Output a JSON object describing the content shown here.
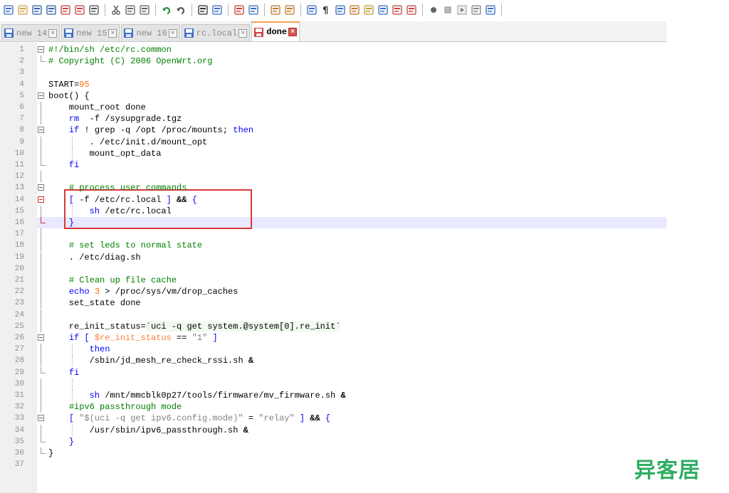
{
  "toolbar": {
    "icons": [
      "new-file-icon",
      "open-file-icon",
      "save-icon",
      "save-all-icon",
      "close-icon",
      "close-all-icon",
      "print-icon",
      "cut-icon",
      "copy-icon",
      "paste-icon",
      "undo-icon",
      "redo-icon",
      "find-icon",
      "replace-icon",
      "zoom-in-icon",
      "zoom-out-icon",
      "sync-vertical-icon",
      "sync-horizontal-icon",
      "word-wrap-icon",
      "show-all-chars-icon",
      "indent-guide-icon",
      "user-language-icon",
      "doc-map-icon",
      "function-list-icon",
      "folder-workspace-icon",
      "monitor-icon",
      "record-macro-icon",
      "stop-macro-icon",
      "play-macro-icon",
      "run-macro-multiple-icon",
      "save-macro-icon"
    ]
  },
  "tabs": [
    {
      "label": "new 14",
      "icon": "document-blue",
      "active": false
    },
    {
      "label": "new 15",
      "icon": "document-blue",
      "active": false
    },
    {
      "label": "new 16",
      "icon": "document-blue",
      "active": false
    },
    {
      "label": "rc.local",
      "icon": "document-blue",
      "active": false
    },
    {
      "label": "done",
      "icon": "document-red",
      "active": true
    }
  ],
  "tab_close_glyph": "×",
  "editor": {
    "current_line": 16,
    "lines": [
      {
        "n": "1",
        "tokens": [
          [
            "cm",
            "#!/bin/sh /etc/rc.common"
          ]
        ]
      },
      {
        "n": "2",
        "tokens": [
          [
            "cm",
            "# Copyright (C) 2006 OpenWrt.org"
          ]
        ]
      },
      {
        "n": "3",
        "tokens": []
      },
      {
        "n": "4",
        "tokens": [
          [
            "",
            "START="
          ],
          [
            "num",
            "95"
          ]
        ]
      },
      {
        "n": "5",
        "tokens": [
          [
            "",
            "boot() {"
          ]
        ]
      },
      {
        "n": "6",
        "tokens": [
          [
            "",
            "    mount_root done"
          ]
        ]
      },
      {
        "n": "7",
        "tokens": [
          [
            "",
            "    "
          ],
          [
            "kw",
            "rm"
          ],
          [
            "",
            "  -f /sysupgrade.tgz"
          ]
        ]
      },
      {
        "n": "8",
        "tokens": [
          [
            "",
            "    "
          ],
          [
            "kw",
            "if"
          ],
          [
            "",
            " ! grep -q /opt /proc/mounts; "
          ],
          [
            "kw",
            "then"
          ]
        ]
      },
      {
        "n": "9",
        "tokens": [
          [
            "",
            "        . /etc/init.d/mount_opt"
          ]
        ]
      },
      {
        "n": "10",
        "tokens": [
          [
            "",
            "        mount_opt_data"
          ]
        ]
      },
      {
        "n": "11",
        "tokens": [
          [
            "",
            "    "
          ],
          [
            "kw",
            "fi"
          ]
        ]
      },
      {
        "n": "12",
        "tokens": []
      },
      {
        "n": "13",
        "tokens": [
          [
            "",
            "    "
          ],
          [
            "cm",
            "# process user commands"
          ]
        ]
      },
      {
        "n": "14",
        "tokens": [
          [
            "",
            "    "
          ],
          [
            "kw",
            "["
          ],
          [
            "",
            " -f /etc/rc.local "
          ],
          [
            "kw",
            "]"
          ],
          [
            "",
            " "
          ],
          [
            "op",
            "&&"
          ],
          [
            "",
            " "
          ],
          [
            "kw",
            "{"
          ]
        ]
      },
      {
        "n": "15",
        "tokens": [
          [
            "",
            "        "
          ],
          [
            "kw",
            "sh"
          ],
          [
            "",
            " /etc/rc.local"
          ]
        ]
      },
      {
        "n": "16",
        "tokens": [
          [
            "",
            "    "
          ],
          [
            "kw",
            "}"
          ]
        ]
      },
      {
        "n": "17",
        "tokens": []
      },
      {
        "n": "18",
        "tokens": [
          [
            "",
            "    "
          ],
          [
            "cm",
            "# set leds to normal state"
          ]
        ]
      },
      {
        "n": "19",
        "tokens": [
          [
            "",
            "    . /etc/diag.sh"
          ]
        ]
      },
      {
        "n": "20",
        "tokens": []
      },
      {
        "n": "21",
        "tokens": [
          [
            "",
            "    "
          ],
          [
            "cm",
            "# Clean up file cache"
          ]
        ]
      },
      {
        "n": "22",
        "tokens": [
          [
            "",
            "    "
          ],
          [
            "kw",
            "echo"
          ],
          [
            "",
            " "
          ],
          [
            "num",
            "3"
          ],
          [
            "",
            " > /proc/sys/vm/drop_caches"
          ]
        ]
      },
      {
        "n": "23",
        "tokens": [
          [
            "",
            "    set_state done"
          ]
        ]
      },
      {
        "n": "24",
        "tokens": []
      },
      {
        "n": "25",
        "tokens": [
          [
            "",
            "    re_init_status="
          ],
          [
            "bt",
            "`uci -q get system.@system[0].re_init`"
          ]
        ]
      },
      {
        "n": "26",
        "tokens": [
          [
            "",
            "    "
          ],
          [
            "kw",
            "if"
          ],
          [
            "",
            " "
          ],
          [
            "kw",
            "["
          ],
          [
            "",
            " "
          ],
          [
            "var",
            "$re_init_status"
          ],
          [
            "",
            " == "
          ],
          [
            "str",
            "\"1\""
          ],
          [
            "",
            " "
          ],
          [
            "kw",
            "]"
          ]
        ]
      },
      {
        "n": "27",
        "tokens": [
          [
            "",
            "        "
          ],
          [
            "kw",
            "then"
          ]
        ]
      },
      {
        "n": "28",
        "tokens": [
          [
            "",
            "        /sbin/jd_mesh_re_check_rssi.sh "
          ],
          [
            "op",
            "&"
          ]
        ]
      },
      {
        "n": "29",
        "tokens": [
          [
            "",
            "    "
          ],
          [
            "kw",
            "fi"
          ]
        ]
      },
      {
        "n": "30",
        "tokens": []
      },
      {
        "n": "31",
        "tokens": [
          [
            "",
            "        "
          ],
          [
            "kw",
            "sh"
          ],
          [
            "",
            " /mnt/mmcblk0p27/tools/firmware/mv_firmware.sh "
          ],
          [
            "op",
            "&"
          ]
        ]
      },
      {
        "n": "32",
        "tokens": [
          [
            "",
            "    "
          ],
          [
            "cm",
            "#ipv6 passthrough mode"
          ]
        ]
      },
      {
        "n": "33",
        "tokens": [
          [
            "",
            "    "
          ],
          [
            "kw",
            "["
          ],
          [
            "",
            " "
          ],
          [
            "str",
            "\"$(uci -q get ipv6.config.mode)\""
          ],
          [
            "",
            " = "
          ],
          [
            "str",
            "\"relay\""
          ],
          [
            "",
            " "
          ],
          [
            "kw",
            "]"
          ],
          [
            "",
            " "
          ],
          [
            "op",
            "&&"
          ],
          [
            "",
            " "
          ],
          [
            "kw",
            "{"
          ]
        ]
      },
      {
        "n": "34",
        "tokens": [
          [
            "",
            "        /usr/sbin/ipv6_passthrough.sh "
          ],
          [
            "op",
            "&"
          ]
        ]
      },
      {
        "n": "35",
        "tokens": [
          [
            "",
            "    "
          ],
          [
            "kw",
            "}"
          ]
        ]
      },
      {
        "n": "36",
        "tokens": [
          [
            "",
            "}"
          ]
        ]
      },
      {
        "n": "37",
        "tokens": []
      }
    ]
  },
  "watermark": {
    "text": "异客居",
    "color": "#2fae63"
  },
  "colors": {
    "keyword": "#0000ff",
    "comment": "#008000",
    "number": "#ff6a00",
    "highlight_box": "#d9383a",
    "current_line": "#e8e8ff"
  }
}
